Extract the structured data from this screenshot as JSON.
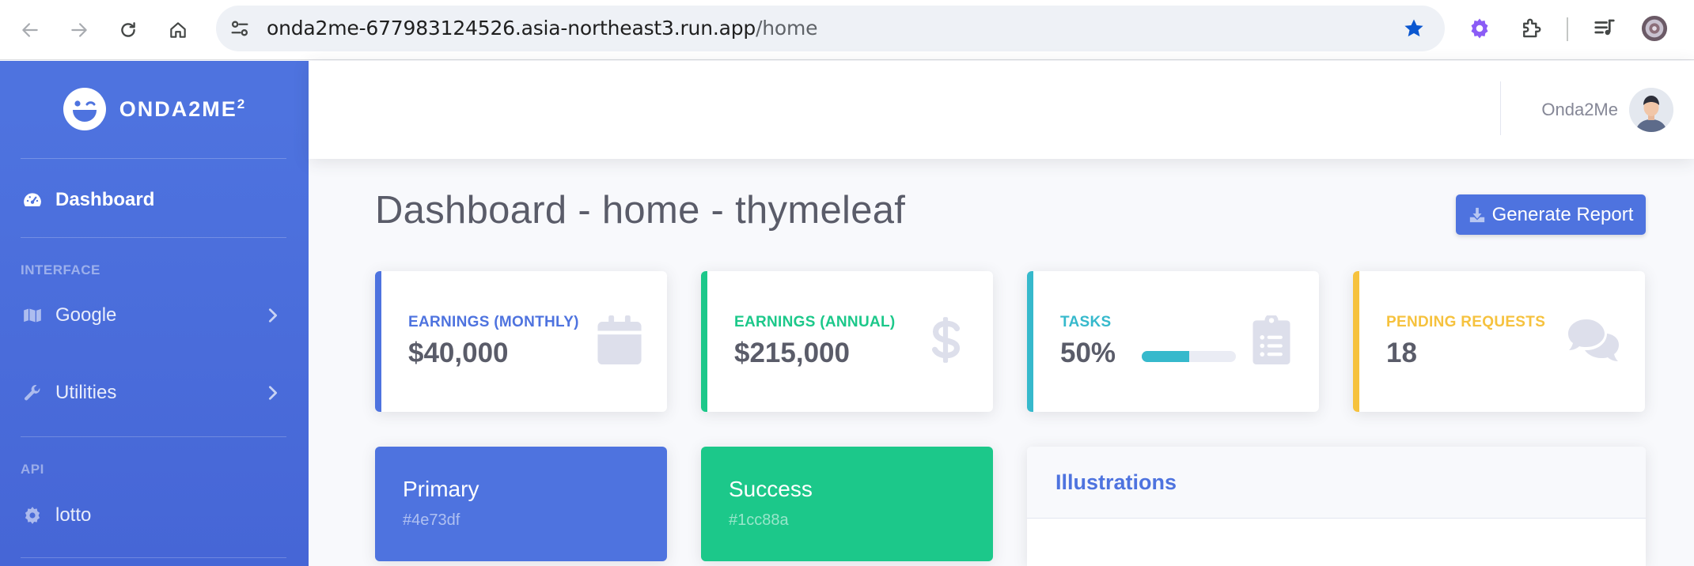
{
  "browser": {
    "url_host": "onda2me-677983124526.asia-northeast3.run.app",
    "url_path": "/home"
  },
  "sidebar": {
    "brand": "ONDA2ME",
    "brand_sup": "2",
    "dashboard_label": "Dashboard",
    "heading_interface": "INTERFACE",
    "google_label": "Google",
    "utilities_label": "Utilities",
    "heading_api": "API",
    "lotto_label": "lotto"
  },
  "topbar": {
    "username": "Onda2Me"
  },
  "main": {
    "title": "Dashboard - home - thymeleaf",
    "generate_report": "Generate Report"
  },
  "cards": [
    {
      "title": "EARNINGS (MONTHLY)",
      "value": "$40,000",
      "color": "#4e73df",
      "icon": "calendar-icon"
    },
    {
      "title": "EARNINGS (ANNUAL)",
      "value": "$215,000",
      "color": "#1cc88a",
      "icon": "dollar-icon"
    },
    {
      "title": "TASKS",
      "value": "50%",
      "color": "#36b9cc",
      "icon": "clipboard-list-icon",
      "progress": 0.5
    },
    {
      "title": "PENDING REQUESTS",
      "value": "18",
      "color": "#f6c23e",
      "icon": "comments-icon"
    }
  ],
  "color_cards": [
    {
      "name": "Primary",
      "hex": "#4e73df"
    },
    {
      "name": "Success",
      "hex": "#1cc88a"
    }
  ],
  "illustrations": {
    "title": "Illustrations"
  }
}
